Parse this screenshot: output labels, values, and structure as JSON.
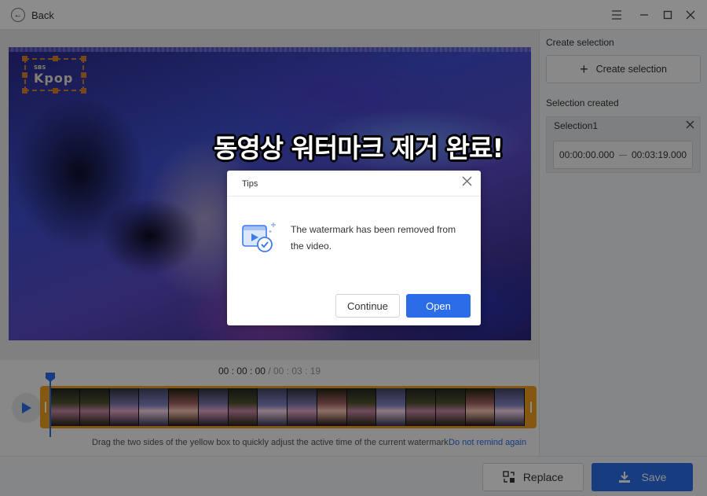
{
  "titlebar": {
    "back_label": "Back",
    "back_icon": "arrow-left-icon",
    "controls": [
      "menu-icon",
      "minimize-icon",
      "maximize-icon",
      "close-icon"
    ]
  },
  "video": {
    "overlay_text": "동영상 워터마크 제거 완료!",
    "watermark_logo_small": "SBS",
    "watermark_logo": "Kpop"
  },
  "timeline": {
    "current_time": "00 : 00 : 00",
    "separator": " / ",
    "total_time": "00 : 03 : 19",
    "hint": "Drag the two sides of the yellow box to quickly adjust the active time of the current watermark",
    "hint_link": "Do not remind again"
  },
  "sidebar": {
    "create_heading": "Create selection",
    "create_button": "Create selection",
    "created_heading": "Selection created",
    "selection": {
      "name": "Selection1",
      "start": "00:00:00.000",
      "end": "00:03:19.000"
    }
  },
  "bottombar": {
    "replace_label": "Replace",
    "save_label": "Save"
  },
  "dialog": {
    "title": "Tips",
    "message": "The watermark has been removed from the video.",
    "continue_label": "Continue",
    "open_label": "Open"
  },
  "colors": {
    "accent": "#2b6de8",
    "timeline_border": "#f0a020",
    "watermark_box": "#d9822b"
  }
}
